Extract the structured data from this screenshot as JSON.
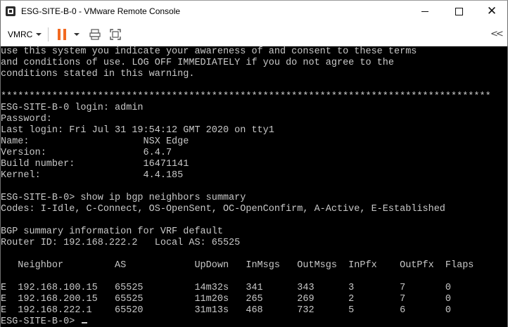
{
  "window": {
    "title": "ESG-SITE-B-0 - VMware Remote Console",
    "minimize_glyph": "—",
    "maximize_glyph": "☐",
    "close_glyph": "✕"
  },
  "toolbar": {
    "vmrc_menu_label": "VMRC",
    "icons": [
      "pause-icon",
      "devices-icon",
      "fullscreen-icon",
      "collapse-icon"
    ],
    "accent_color": "#f26a21",
    "collapse_glyph": "<<"
  },
  "console": {
    "text_color": "#c8c8c8",
    "background": "#000000",
    "lines": [
      "use this system you indicate your awareness of and consent to these terms",
      "and conditions of use. LOG OFF IMMEDIATELY if you do not agree to the",
      "conditions stated in this warning.",
      "",
      "**************************************************************************************",
      "ESG-SITE-B-0 login: admin",
      "Password:",
      "Last login: Fri Jul 31 19:54:12 GMT 2020 on tty1",
      "Name:                    NSX Edge",
      "Version:                 6.4.7",
      "Build number:            16471141",
      "Kernel:                  4.4.185",
      "",
      "ESG-SITE-B-0> show ip bgp neighbors summary",
      "Codes: I-Idle, C-Connect, OS-OpenSent, OC-OpenConfirm, A-Active, E-Established",
      "",
      "BGP summary information for VRF default",
      "Router ID: 192.168.222.2   Local AS: 65525",
      "",
      "   Neighbor         AS            UpDown   InMsgs   OutMsgs  InPfx    OutPfx  Flaps",
      "",
      "E  192.168.100.15   65525         14m32s   341      343      3        7       0",
      "E  192.168.200.15   65525         11m20s   265      269      2        7       0",
      "E  192.168.222.1    65520         31m13s   468      732      5        6       0"
    ],
    "prompt": "ESG-SITE-B-0> "
  }
}
